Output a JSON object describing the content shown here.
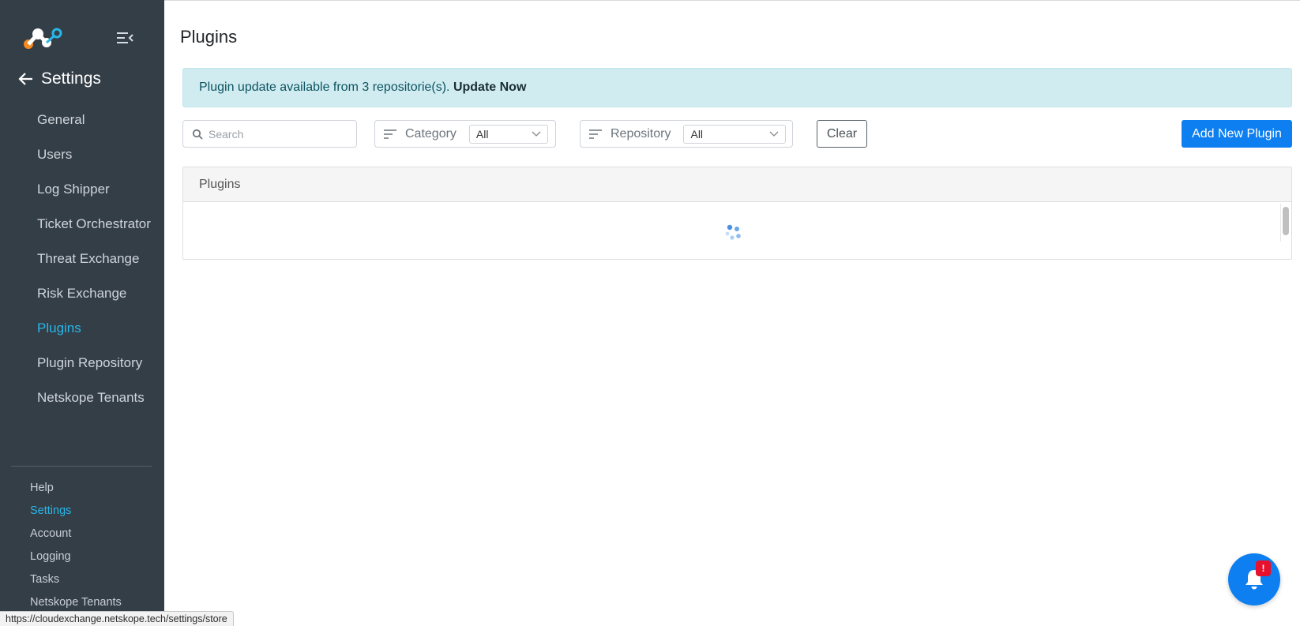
{
  "app": {
    "logo_icon": "netskope-logo",
    "accent_color": "#29b6e8",
    "primary_color": "#0d7ff0"
  },
  "sidebar": {
    "collapse_icon": "menu-collapse-icon",
    "section_title": "Settings",
    "items": [
      {
        "label": "General",
        "active": false
      },
      {
        "label": "Users",
        "active": false
      },
      {
        "label": "Log Shipper",
        "active": false
      },
      {
        "label": "Ticket Orchestrator",
        "active": false
      },
      {
        "label": "Threat Exchange",
        "active": false
      },
      {
        "label": "Risk Exchange",
        "active": false
      },
      {
        "label": "Plugins",
        "active": true
      },
      {
        "label": "Plugin Repository",
        "active": false
      },
      {
        "label": "Netskope Tenants",
        "active": false
      }
    ],
    "bottom_items": [
      {
        "label": "Help",
        "active": false
      },
      {
        "label": "Settings",
        "active": true
      },
      {
        "label": "Account",
        "active": false
      },
      {
        "label": "Logging",
        "active": false
      },
      {
        "label": "Tasks",
        "active": false
      },
      {
        "label": "Netskope Tenants",
        "active": false
      }
    ]
  },
  "main": {
    "title": "Plugins",
    "banner": {
      "text": "Plugin update available from 3 repositorie(s).",
      "action": "Update Now"
    },
    "filters": {
      "search_placeholder": "Search",
      "category_label": "Category",
      "category_value": "All",
      "repository_label": "Repository",
      "repository_value": "All",
      "clear_label": "Clear",
      "add_label": "Add New Plugin"
    },
    "card": {
      "header": "Plugins"
    }
  },
  "notification": {
    "badge": "!"
  },
  "status_bar": {
    "url": "https://cloudexchange.netskope.tech/settings/store"
  }
}
